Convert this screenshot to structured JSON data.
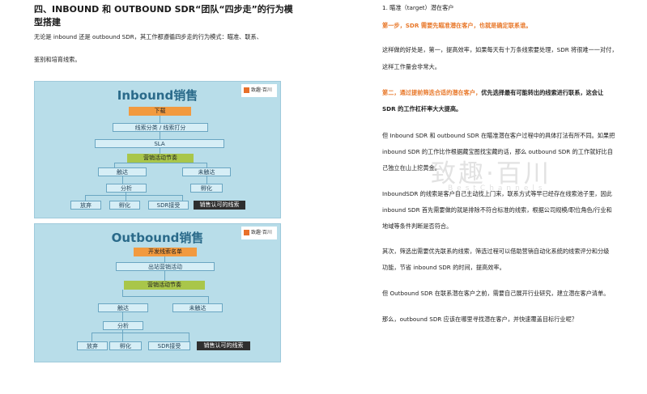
{
  "left": {
    "heading": "四、INBOUND 和 OUTBOUND SDR“团队“四步走”的行为模型搭建",
    "intro_line1": "无论是 inbound 还是 outbound SDR，其工作都遵循四步走的行为模式：瞄准、联系、",
    "intro_line2": "鉴别和培育线索。",
    "inbound": {
      "title": "Inbound销售",
      "logo_text": "致趣·百川",
      "boxes": {
        "download": "下载",
        "classify": "线索分类 / 线索打分",
        "sla": "SLA",
        "marketing": "营销活动节奏",
        "reached": "触达",
        "not_reached": "未触达",
        "analysis": "分析",
        "nurture_right": "孵化",
        "discard": "放弃",
        "nurture": "孵化",
        "sdr_accept": "SDR接受",
        "sales_qualified": "销售认可的线索"
      }
    },
    "outbound": {
      "title": "Outbound销售",
      "logo_text": "致趣·百川",
      "boxes": {
        "develop_list": "开发线索名单",
        "outbound_activity": "出站营销活动",
        "marketing": "营销活动节奏",
        "reached": "触达",
        "not_reached": "未触达",
        "analysis": "分析",
        "discard": "放弃",
        "nurture": "孵化",
        "sdr_accept": "SDR接受",
        "sales_qualified": "销售认可的线索"
      }
    }
  },
  "right": {
    "item1": "1. 瞄准（target）潜在客户",
    "step1": "第一步，SDR 需要先瞄准潜在客户，也就是确定联系谁。",
    "p1_line1": "这样做的好处是，第一，提高效率，如果每天有十万条线索要处理，SDR 将很难一一对付，",
    "p1_line2": "这样工作量会非常大。",
    "step2_prefix": "第二，通过提前筛选合适的潜在客户，",
    "step2_suffix": "优先选择最有可能转出的线索进行联系，这会让",
    "p2_line2": "SDR 的工作杠杆率大大提高。",
    "p3_line1": "但 Inbound SDR 和 outbound SDR 在瞄准潜在客户过程中的具体打法有所不同。如果把",
    "p3_line2": "inbound SDR 的工作比作根据藏宝图找宝藏的话，那么 outbound SDR 的工作就好比自",
    "p3_line3": "己独立在山上挖黄金。",
    "p4_line1": "InboundSDR 的线索是客户自己主动找上门来，联系方式等早已经存在线索池子里，因此",
    "p4_line2": "inbound SDR 首先需要做的就是排除不符合标准的线索，根据公司规模/职位角色/行业和",
    "p4_line3": "地域等条件判断是否符合。",
    "p5_line1": "其次，筛选出需要优先联系的线索，筛选过程可以借助营销自动化系统的线索评分和分级",
    "p5_line2": "功能，节省 inbound SDR 的时间，提高效率。",
    "p6": "但 Outbound SDR 在联系潜在客户之前，需要自己展开行业研究，建立潜在客户清单。",
    "p7": "那么，outbound SDR 应该在哪里寻找潜在客户，并快速覆盖目标行业呢？",
    "watermark": "致趣·百川",
    "watermark_sub": "BestChannels"
  },
  "colors": {
    "orange": "#e8782a",
    "diagram_bg": "#b8dde9",
    "box_green": "#a9c64a",
    "box_orange": "#f29a3f",
    "box_dark": "#2f2f2f"
  }
}
